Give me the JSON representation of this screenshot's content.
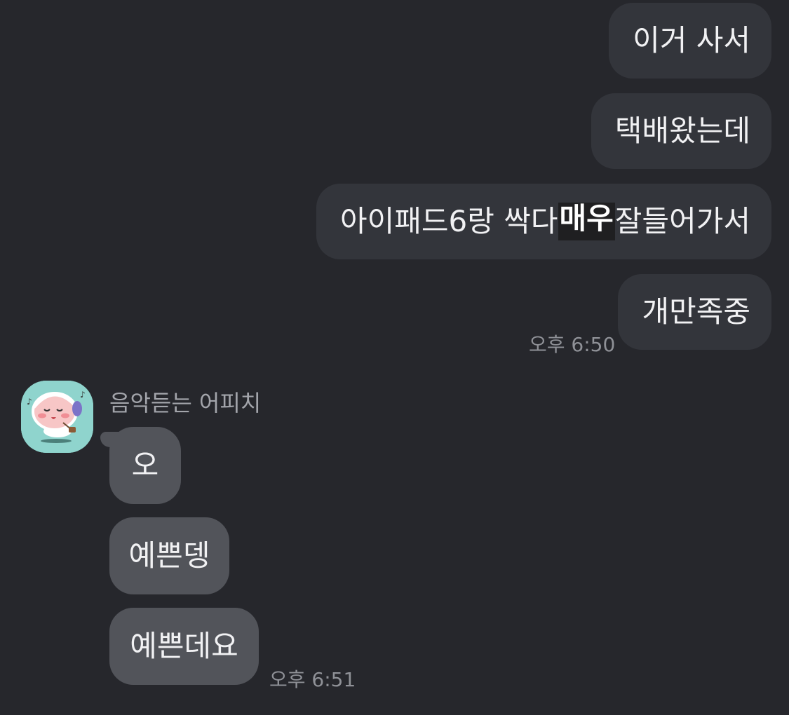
{
  "sent_messages": [
    {
      "text": "이거 사서"
    },
    {
      "text": "택배왔는데"
    },
    {
      "text_before": "아이패드6랑 싹다",
      "text_highlight": "매우",
      "text_after": "잘들어가서"
    },
    {
      "text": "개만족중"
    }
  ],
  "sent_time": "오후 6:50",
  "received": {
    "sender_name": "음악듣는 어피치",
    "avatar_icon": "apeach-headphones-icon",
    "messages": [
      {
        "text": "오"
      },
      {
        "text": "예쁜뎅"
      },
      {
        "text": "예쁜데요"
      }
    ],
    "time": "오후 6:51"
  },
  "colors": {
    "background": "#26272c",
    "sent_bubble": "#33353b",
    "received_bubble": "#52545a",
    "timestamp": "#8f9197"
  }
}
